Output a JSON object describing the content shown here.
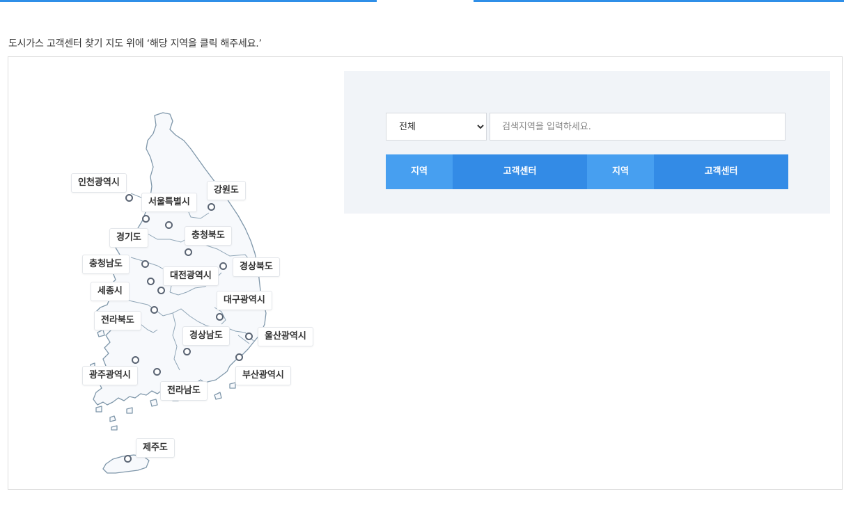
{
  "instruction": "도시가스 고객센터 찾기 지도 위에 ‘해당 지역을 클릭 해주세요.’",
  "map": {
    "regions": [
      {
        "label": "인천광역시"
      },
      {
        "label": "서울특별시"
      },
      {
        "label": "강원도"
      },
      {
        "label": "경기도"
      },
      {
        "label": "충청북도"
      },
      {
        "label": "충청남도"
      },
      {
        "label": "대전광역시"
      },
      {
        "label": "경상북도"
      },
      {
        "label": "세종시"
      },
      {
        "label": "대구광역시"
      },
      {
        "label": "전라북도"
      },
      {
        "label": "경상남도"
      },
      {
        "label": "울산광역시"
      },
      {
        "label": "광주광역시"
      },
      {
        "label": "부산광역시"
      },
      {
        "label": "전라남도"
      },
      {
        "label": "제주도"
      }
    ]
  },
  "search": {
    "select_value": "전체",
    "select_options": [
      "전체"
    ],
    "input_placeholder": "검색지역을 입력하세요.",
    "input_value": ""
  },
  "table": {
    "headers": [
      "지역",
      "고객센터",
      "지역",
      "고객센터"
    ]
  },
  "colors": {
    "accent": "#2f8fe8",
    "header_light": "#479ff0",
    "header_dark": "#338be6",
    "marker": "#5a6473",
    "map_outline": "#7f97aa",
    "map_fill": "#f7f9fc",
    "search_bg": "#f1f4f8"
  }
}
